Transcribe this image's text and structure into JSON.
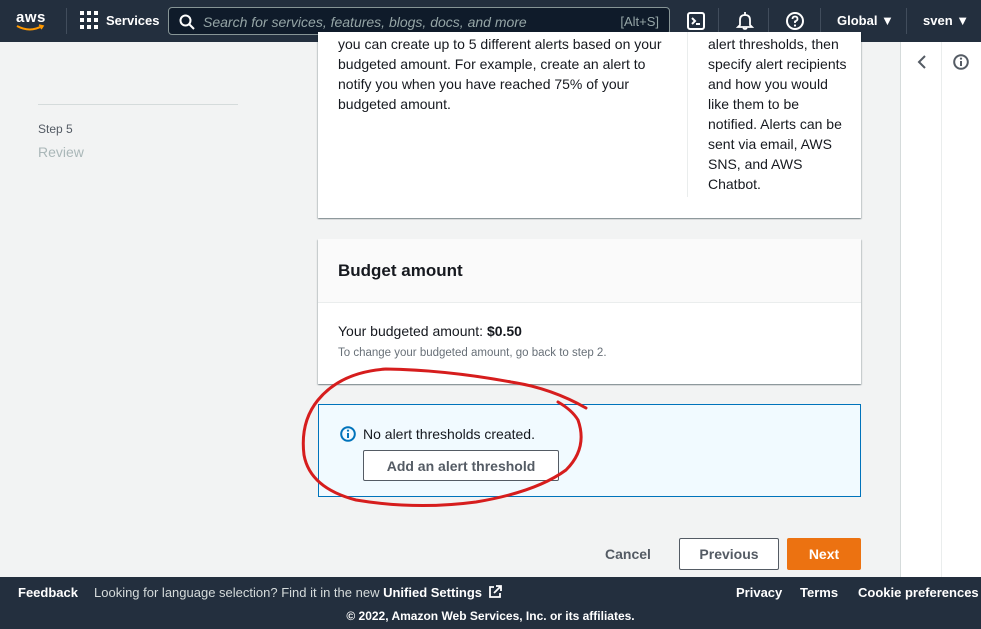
{
  "topnav": {
    "logo": "aws",
    "services": "Services",
    "search_placeholder": "Search for services, features, blogs, docs, and more",
    "search_shortcut": "[Alt+S]",
    "region": "Global ▼",
    "user": "sven ▼"
  },
  "steps": {
    "step_number": "Step 5",
    "step_title": "Review"
  },
  "alerts_card": {
    "left_text": "you can create up to 5 different alerts based on your budgeted amount. For example, create an alert to notify you when you have reached 75% of your budgeted amount.",
    "right_text": "alert thresholds, then specify alert recipients and how you would like them to be notified. Alerts can be sent via email, AWS SNS, and AWS Chatbot."
  },
  "budget_card": {
    "title": "Budget amount",
    "amount_label": "Your budgeted amount: ",
    "amount_value": "$0.50",
    "hint": "To change your budgeted amount, go back to step 2."
  },
  "info_box": {
    "message": "No alert thresholds created.",
    "button": "Add an alert threshold"
  },
  "actions": {
    "cancel": "Cancel",
    "previous": "Previous",
    "next": "Next"
  },
  "footer": {
    "feedback": "Feedback",
    "lang_text": "Looking for language selection? Find it in the new ",
    "lang_link": "Unified Settings",
    "privacy": "Privacy",
    "terms": "Terms",
    "cookies": "Cookie preferences",
    "copyright": "© 2022, Amazon Web Services, Inc. or its affiliates."
  },
  "colors": {
    "nav_bg": "#232f3e",
    "accent_orange": "#ec7211",
    "info_blue": "#0073bb",
    "annotation_red": "#d61d1d"
  }
}
